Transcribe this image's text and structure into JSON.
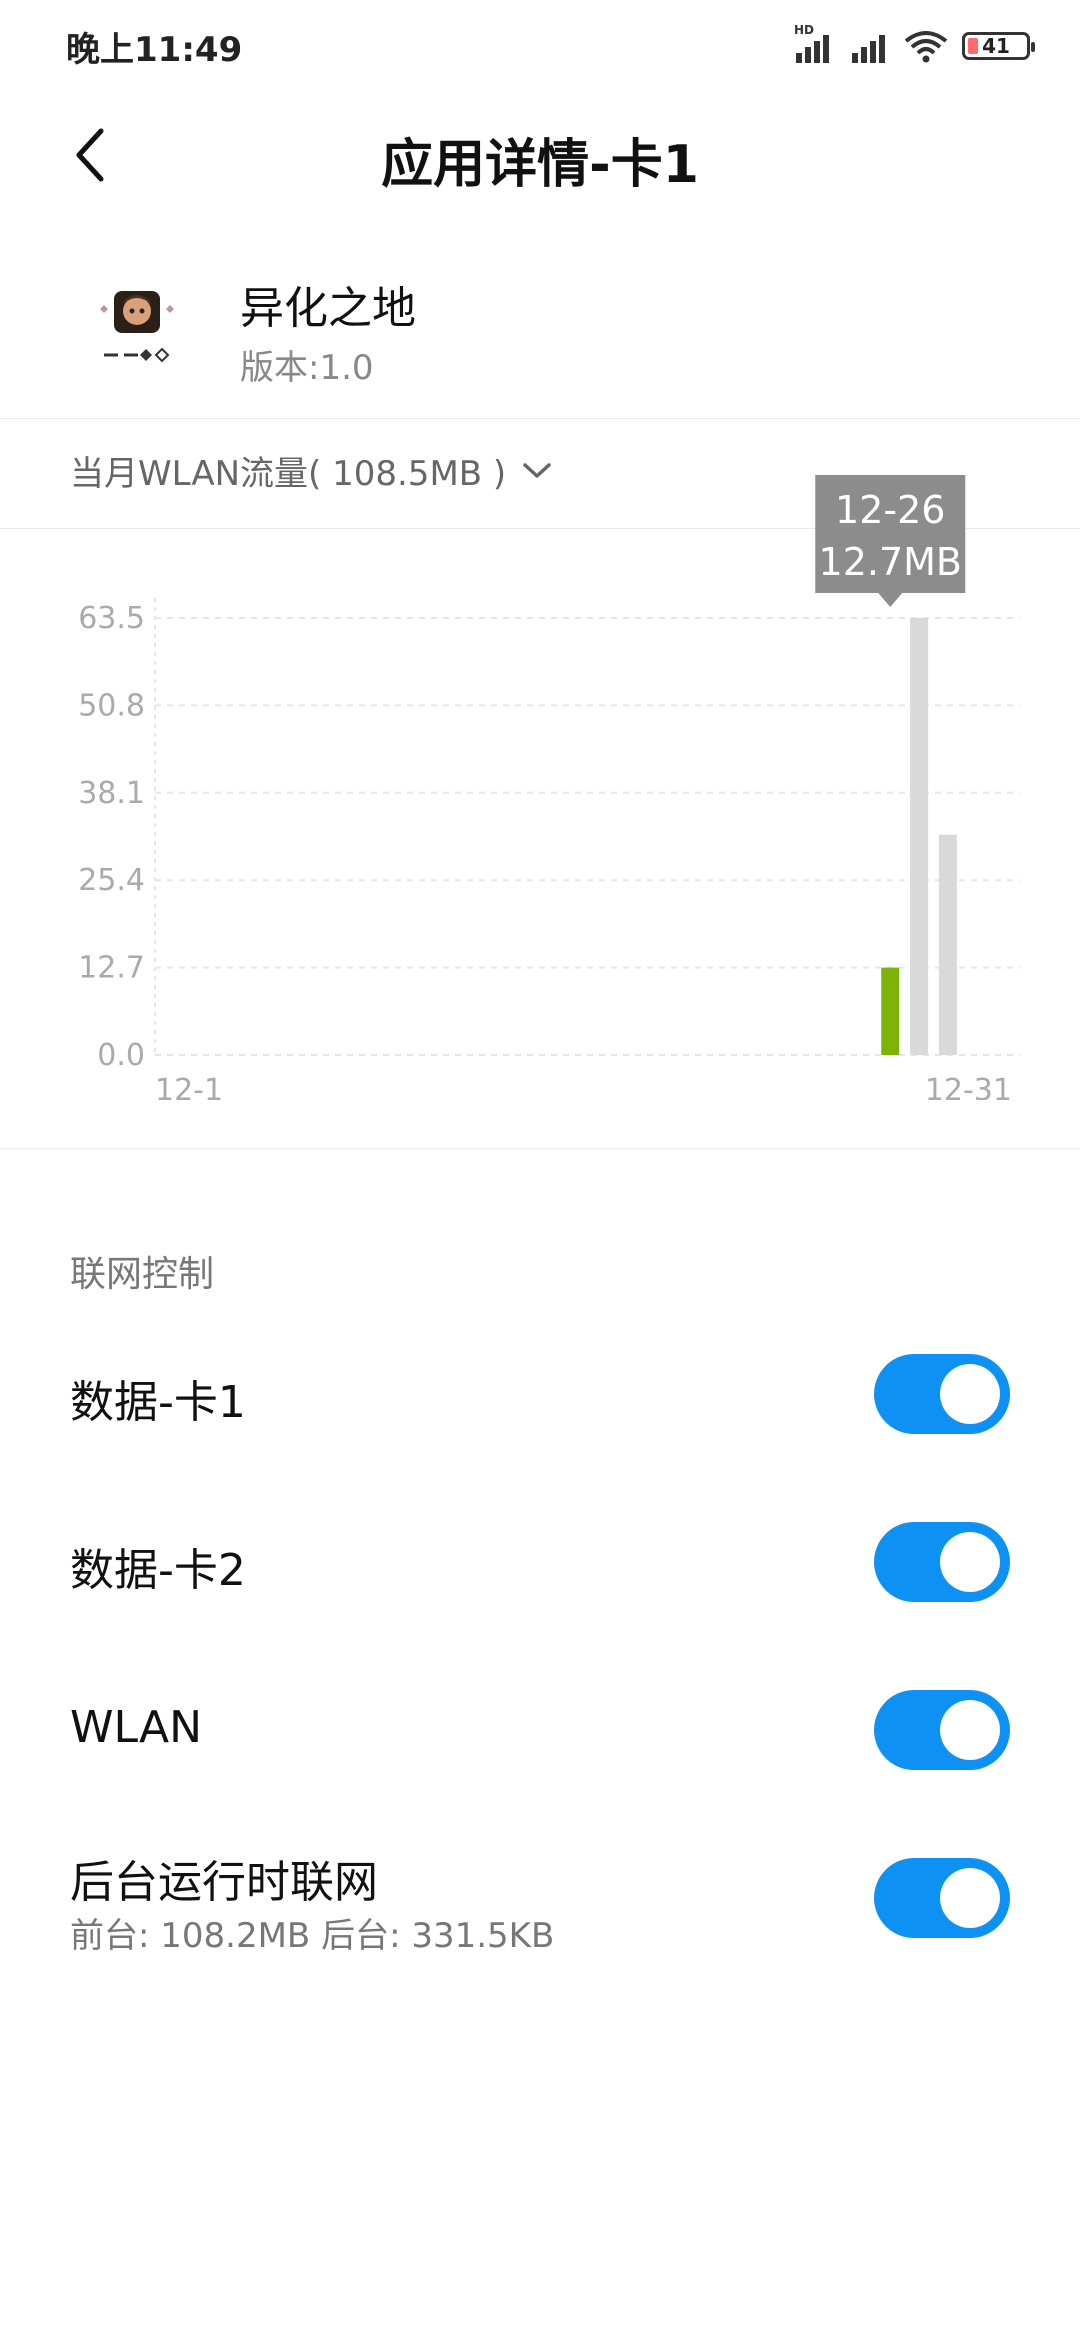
{
  "status_bar": {
    "time": "晚上11:49",
    "network_badge": "HD",
    "battery": "41",
    "icons": [
      "signal-hd-icon",
      "signal-icon",
      "wifi-icon",
      "battery-icon"
    ]
  },
  "header": {
    "title": "应用详情-卡1",
    "back_icon": "chevron-left-icon"
  },
  "app": {
    "name": "异化之地",
    "version": "版本:1.0"
  },
  "data_selector": {
    "label": "当月WLAN流量( 108.5MB )",
    "icon": "chevron-down-icon"
  },
  "chart_data": {
    "type": "bar",
    "x_range": [
      1,
      31
    ],
    "x_labels": [
      "12-1",
      "12-31"
    ],
    "y_ticks": [
      "0.0",
      "12.7",
      "25.4",
      "38.1",
      "50.8",
      "63.5"
    ],
    "ylim": [
      0,
      63.5
    ],
    "unit": "MB",
    "bars": [
      {
        "day": 26,
        "value": 12.7,
        "selected": true
      },
      {
        "day": 27,
        "value": 63.5,
        "selected": false
      },
      {
        "day": 28,
        "value": 32.0,
        "selected": false
      }
    ],
    "tooltip": {
      "date": "12-26",
      "value": "12.7MB"
    },
    "colors": {
      "selected": "#7cb305",
      "default": "#d9d9d9",
      "tooltip_bg": "#8c8c8c",
      "grid": "#e6e6e6"
    }
  },
  "network_control": {
    "section_label": "联网控制",
    "rows": [
      {
        "label": "数据-卡1",
        "enabled": true
      },
      {
        "label": "数据-卡2",
        "enabled": true
      },
      {
        "label": "WLAN",
        "enabled": true
      },
      {
        "label": "后台运行时联网",
        "sub": "前台: 108.2MB  后台: 331.5KB",
        "enabled": true
      }
    ],
    "toggle_color": "#0d92f3"
  }
}
